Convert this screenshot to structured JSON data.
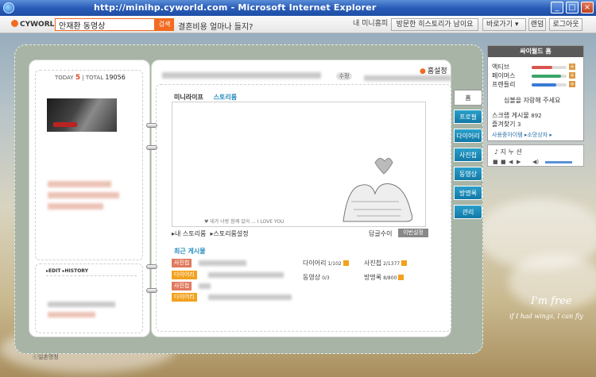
{
  "window": {
    "title": "http://minihp.cyworld.com - Microsoft Internet Explorer",
    "buttons": [
      "_",
      "□",
      "×"
    ]
  },
  "topbar": {
    "logo": "CYWORLD",
    "search_value": "안재환 동영상",
    "search_button": "검색",
    "ad_link": "결혼비용 얼마나 들지?",
    "my_mini": "내 미니홈피",
    "visited": "방문한 히스토리가 남이요",
    "goto": "바로가기",
    "random": "랜덤",
    "logout": "로그아웃"
  },
  "left": {
    "today_label": "TODAY",
    "today_value": "5",
    "total_label": "TOTAL",
    "total_value": "19056",
    "edit": "▸EDIT",
    "history": "▸HISTORY"
  },
  "main": {
    "edit_pill": "수정",
    "home_settings": "홈설정",
    "tabs": [
      "미니라이프",
      "스토리룸"
    ],
    "stage_caption": "♥ 네가 너랑 함께 있어 ... I LOVE YOU",
    "story_left": "▸내 스토리룸",
    "story_right": "▸스토리룸설정",
    "reply_label": "답글수이",
    "reply_button": "이번설정",
    "recent_title": "최근 게시물",
    "recent_tags": [
      "사진첩",
      "다이어리",
      "사진첩",
      "다이어리"
    ],
    "stats": [
      {
        "label": "다이어리",
        "value": "1/102"
      },
      {
        "label": "사진첩",
        "value": "2/1377"
      },
      {
        "label": "동영상",
        "value": "0/3"
      },
      {
        "label": "방명록",
        "value": "8/800"
      }
    ]
  },
  "side_tabs": [
    "홈",
    "프로필",
    "다이어리",
    "사진첩",
    "동영상",
    "방명록",
    "관리"
  ],
  "widget": {
    "title": "싸이월드 홈",
    "gauges": [
      {
        "label": "액티브",
        "color": "#d9534f",
        "level": 0.6
      },
      {
        "label": "페이머스",
        "color": "#3aa66a",
        "level": 0.85
      },
      {
        "label": "프렌들리",
        "color": "#3a7ad6",
        "level": 0.7
      }
    ],
    "praise": "심볼을 자랑해 주세요",
    "scrap_label": "스크랩 게시물",
    "scrap_value": "892",
    "fav_label": "즐겨찾기",
    "fav_value": "3",
    "links": "사용중아이템 ▸소망상자 ▸"
  },
  "player": {
    "song": "지 누 션"
  },
  "backdrop": {
    "title": "I'm free",
    "tagline": "if I had wings, I can fly"
  },
  "footer": "ⓒ일촌명칭"
}
